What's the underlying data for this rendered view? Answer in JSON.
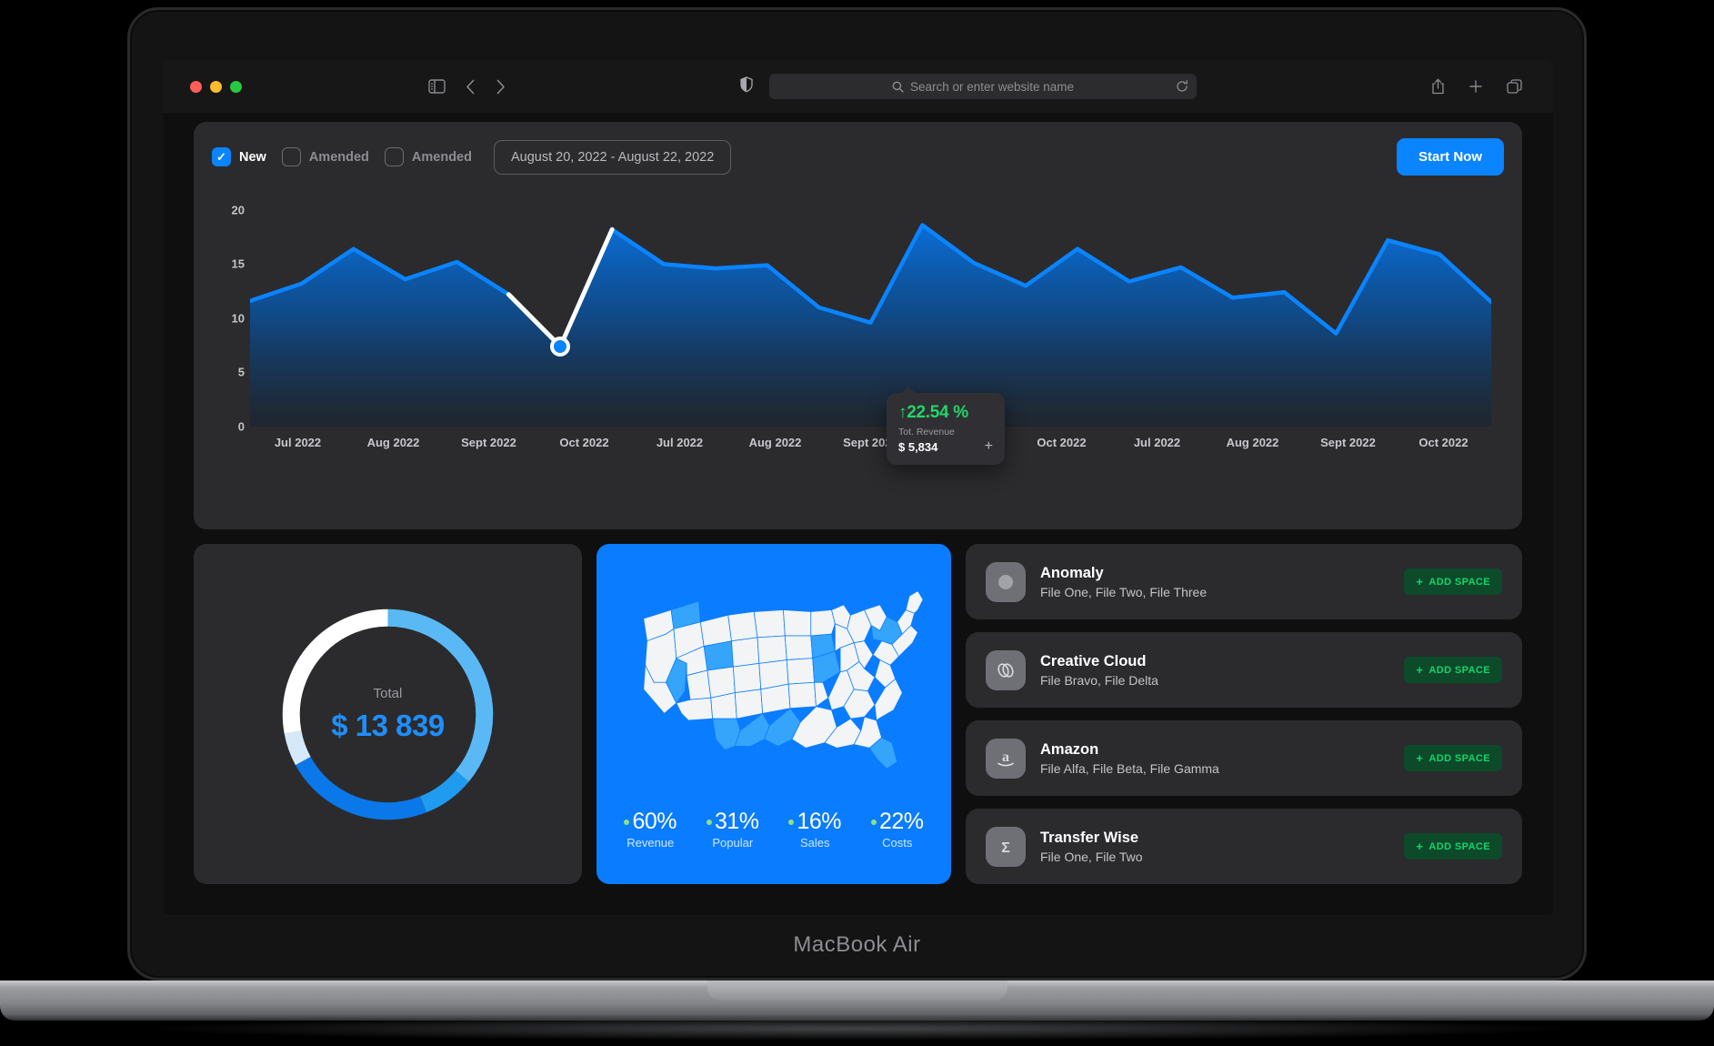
{
  "device": {
    "label": "MacBook Air"
  },
  "browser": {
    "traffic_lights": [
      "close-red",
      "minimize-yellow",
      "maximize-green"
    ],
    "sidebar_icon": "sidebar-toggle-icon",
    "back_icon": "chevron-left-icon",
    "forward_icon": "chevron-right-icon",
    "shield_icon": "shield-icon",
    "search_placeholder": "Search or enter website name",
    "search_value": "",
    "search_icon": "search-icon",
    "reload_icon": "reload-icon",
    "share_icon": "share-icon",
    "new_tab_icon": "plus-icon",
    "tabs_icon": "tab-overview-icon"
  },
  "filters": {
    "items": [
      {
        "label": "New",
        "checked": true
      },
      {
        "label": "Amended",
        "checked": false
      },
      {
        "label": "Amended",
        "checked": false
      }
    ],
    "date_range": "August 20, 2022 - August 22, 2022",
    "start_button": "Start Now"
  },
  "chart_data": {
    "type": "area",
    "title": "",
    "xlabel": "",
    "ylabel": "",
    "ylim": [
      0,
      22
    ],
    "yticks": [
      20,
      15,
      10,
      5,
      0
    ],
    "grid": false,
    "legend": "none",
    "categories": [
      "Jul 2022",
      "Aug 2022",
      "Sept 2022",
      "Oct 2022",
      "Jul 2022",
      "Aug 2022",
      "Sept 2022",
      "Oct 2022",
      "Oct 2022",
      "Jul 2022",
      "Aug 2022",
      "Sept 2022",
      "Oct 2022"
    ],
    "series": [
      {
        "name": "Tot. Revenue",
        "values": [
          11.6,
          13.2,
          16.4,
          13.6,
          15.2,
          12.2,
          7.4,
          18.2,
          15.0,
          14.6,
          14.9,
          11.0,
          9.6,
          18.6,
          15.1,
          13.0,
          16.4,
          13.4,
          14.7,
          11.9,
          12.4,
          8.6,
          17.2,
          15.9,
          11.5
        ]
      }
    ],
    "highlight_point": {
      "index": 6,
      "value": 7.4
    },
    "colors": {
      "line": "#0a84ff",
      "highlight": "#ffffff",
      "area_top": "#0a6ed6",
      "area_bottom": "#14283a"
    }
  },
  "tooltip": {
    "change": "↑22.54 %",
    "label": "Tot. Revenue",
    "value": "$ 5,834",
    "add_icon": "plus-icon"
  },
  "donut": {
    "total_label": "Total",
    "total_value": "$ 13 839",
    "segments": [
      {
        "name": "segment-light-blue",
        "percent": 36,
        "color": "#5ab9f5"
      },
      {
        "name": "segment-bright-blue",
        "percent": 8,
        "color": "#1f9cf0"
      },
      {
        "name": "segment-deep-blue",
        "percent": 23,
        "color": "#0a78e8"
      },
      {
        "name": "segment-pale-blue",
        "percent": 5,
        "color": "#d6e9fb"
      },
      {
        "name": "segment-white",
        "percent": 28,
        "color": "#ffffff"
      }
    ]
  },
  "map": {
    "accent": "#0a7cff",
    "stats": [
      {
        "percent": "60%",
        "label": "Revenue"
      },
      {
        "percent": "31%",
        "label": "Popular"
      },
      {
        "percent": "16%",
        "label": "Sales"
      },
      {
        "percent": "22%",
        "label": "Costs"
      }
    ]
  },
  "apps": {
    "add_label": "ADD SPACE",
    "items": [
      {
        "name": "Anomaly",
        "files": "File One, File Two, File Three",
        "icon": "anomaly-icon"
      },
      {
        "name": "Creative Cloud",
        "files": "File Bravo, File Delta",
        "icon": "creative-cloud-icon"
      },
      {
        "name": "Amazon",
        "files": "File Alfa, File Beta, File Gamma",
        "icon": "amazon-icon"
      },
      {
        "name": "Transfer Wise",
        "files": "File One, File Two",
        "icon": "transferwise-icon"
      }
    ]
  }
}
